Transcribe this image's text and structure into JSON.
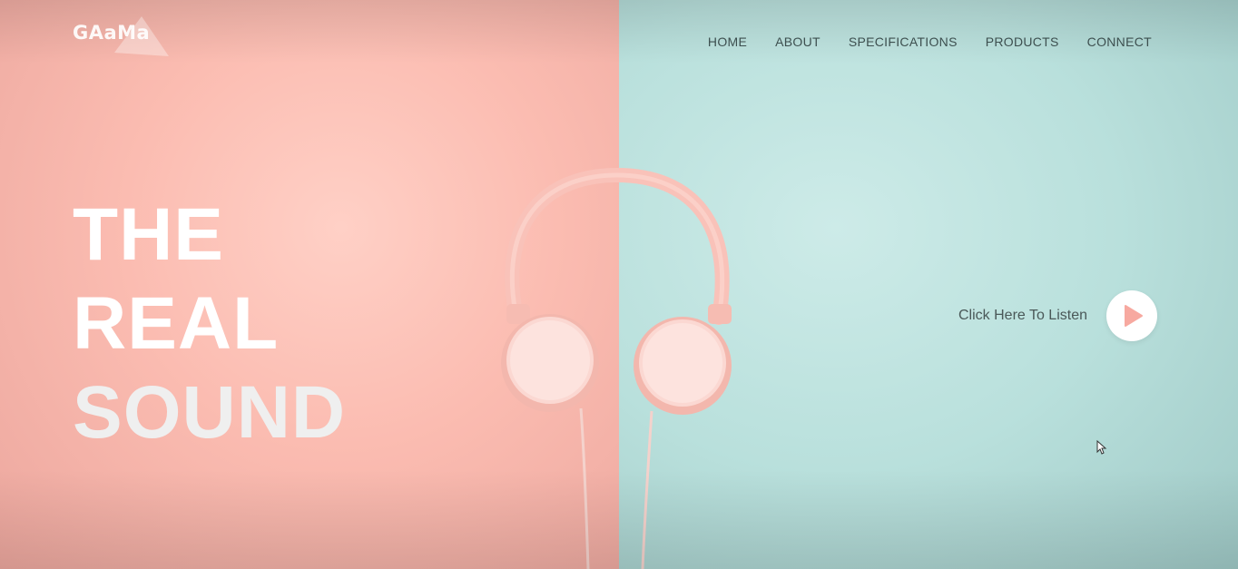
{
  "brand": {
    "logo_text": "GAaMa"
  },
  "nav": {
    "items": [
      {
        "label": "HOME"
      },
      {
        "label": "ABOUT"
      },
      {
        "label": "SPECIFICATIONS"
      },
      {
        "label": "PRODUCTS"
      },
      {
        "label": "CONNECT"
      }
    ]
  },
  "hero": {
    "lines": [
      "THE",
      "REAL",
      "SOUND"
    ]
  },
  "listen": {
    "label": "Click Here To Listen",
    "icon": "play-icon"
  },
  "colors": {
    "left_panel": "#fbbcb1",
    "right_panel": "#b9e0dc",
    "play_accent": "#f7a9a0"
  }
}
